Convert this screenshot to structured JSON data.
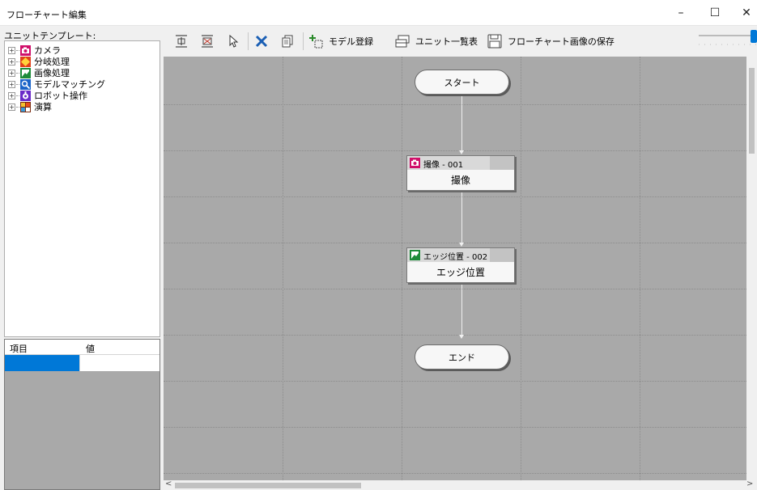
{
  "window": {
    "title": "フローチャート編集",
    "minimize_glyph": "–",
    "maximize_glyph": "☐",
    "close_glyph": "✕"
  },
  "left_panel": {
    "template_label": "ユニットテンプレート:",
    "tree_items": [
      {
        "label": "カメラ",
        "icon": "camera-icon",
        "color": "#d0106a"
      },
      {
        "label": "分岐処理",
        "icon": "branch-icon",
        "color": "#e0401a"
      },
      {
        "label": "画像処理",
        "icon": "image-process-icon",
        "color": "#1e8c3a"
      },
      {
        "label": "モデルマッチング",
        "icon": "model-matching-icon",
        "color": "#1a64c8"
      },
      {
        "label": "ロボット操作",
        "icon": "robot-icon",
        "color": "#6a2ac8"
      },
      {
        "label": "演算",
        "icon": "calculation-icon",
        "color": "#7a2a10"
      }
    ],
    "expand_glyph": "+",
    "property_grid": {
      "col_item": "項目",
      "col_value": "値"
    }
  },
  "toolbar": {
    "items": [
      {
        "icon": "align-vertical-icon"
      },
      {
        "icon": "close-gap-icon"
      },
      {
        "icon": "pointer-icon"
      },
      {
        "icon": "delete-icon",
        "color": "#1a5fb4"
      },
      {
        "icon": "copy-icon"
      },
      {
        "icon": "model-register-icon",
        "label": "モデル登録"
      },
      {
        "icon": "unit-list-icon",
        "label": "ユニット一覧表"
      },
      {
        "icon": "save-icon",
        "label": "フローチャート画像の保存"
      }
    ]
  },
  "flowchart": {
    "start_label": "スタート",
    "end_label": "エンド",
    "nodes": [
      {
        "id_label": "撮像 - 001",
        "name": "撮像",
        "icon": "camera-icon",
        "icon_color": "#d0106a"
      },
      {
        "id_label": "エッジ位置 - 002",
        "name": "エッジ位置",
        "icon": "image-process-icon",
        "icon_color": "#1e8c3a"
      }
    ]
  },
  "scrollbars": {
    "left_arrow": "<",
    "right_arrow": ">"
  }
}
